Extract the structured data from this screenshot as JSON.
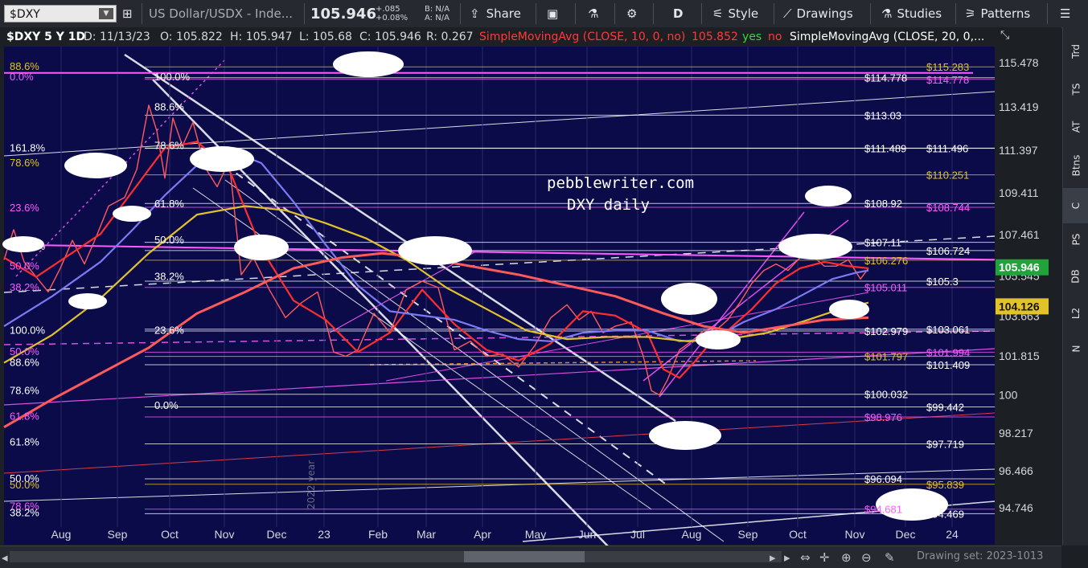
{
  "toolbar": {
    "symbol": "$DXY",
    "name": "US Dollar/USDX - Inde...",
    "last": "105.946",
    "change": "+.085",
    "change_pct": "+0.08%",
    "bid": "B: N/A",
    "ask": "A: N/A",
    "share": "Share",
    "period": "D",
    "style": "Style",
    "drawings": "Drawings",
    "studies": "Studies",
    "patterns": "Patterns"
  },
  "infobar": {
    "title": "$DXY 5 Y 1D",
    "date": "D: 11/13/23",
    "open": "O: 105.822",
    "high": "H: 105.947",
    "low": "L: 105.68",
    "close": "C: 105.946",
    "range": "R: 0.267",
    "sma10": "SimpleMovingAvg (CLOSE, 10, 0, no)",
    "sma10_val": "105.852",
    "yes": "yes",
    "no": "no",
    "sma20": "SimpleMovingAvg (CLOSE, 20, 0,..."
  },
  "sidebar": [
    "Trd",
    "TS",
    "AT",
    "Btns",
    "C",
    "PS",
    "DB",
    "L2",
    "N"
  ],
  "bottom": {
    "drawing_set": "Drawing set: 2023-1013"
  },
  "chart_data": {
    "type": "line",
    "title": "$DXY 5 Y 1D",
    "watermark": [
      "pebblewriter.com",
      "DXY daily"
    ],
    "year_label": "2022 year",
    "x_ticks": [
      "Aug",
      "Sep",
      "Oct",
      "Nov",
      "Dec",
      "23",
      "Feb",
      "Mar",
      "Apr",
      "May",
      "Jun",
      "Jul",
      "Aug",
      "Sep",
      "Oct",
      "Nov",
      "Dec",
      "24"
    ],
    "y_ticks": [
      115.478,
      113.419,
      111.397,
      109.411,
      107.461,
      105.545,
      103.663,
      101.815,
      100,
      98.217,
      96.466,
      94.746
    ],
    "ylim": [
      93.5,
      116.5
    ],
    "last_price": 105.946,
    "sma_badge": 104.126,
    "series": [
      {
        "name": "DXY",
        "color": "#ff5a5a",
        "x": [
          0,
          12,
          25,
          40,
          55,
          70,
          85,
          100,
          115,
          130,
          150,
          165,
          180,
          190,
          200,
          210,
          222,
          235,
          250,
          265,
          280,
          295,
          310,
          330,
          350,
          370,
          390,
          410,
          425,
          440,
          460,
          480,
          500,
          520,
          540,
          560,
          580,
          600,
          620,
          640,
          660,
          680,
          700,
          715,
          730,
          745,
          760,
          780,
          795,
          805,
          815,
          825,
          840,
          855,
          870,
          885,
          900,
          915,
          930,
          945,
          960,
          975,
          990,
          1005,
          1020,
          1035,
          1050,
          1065,
          1075
        ],
        "y": [
          106.3,
          107.7,
          106.2,
          105.5,
          104.8,
          105.9,
          107.2,
          106.1,
          107.4,
          108.8,
          109.2,
          110.5,
          113.5,
          112.3,
          110.1,
          112.9,
          111.6,
          112.7,
          110.6,
          109.7,
          110.9,
          105.6,
          106.4,
          104.9,
          103.6,
          104.3,
          104.8,
          102.0,
          101.8,
          102.1,
          103.8,
          102.9,
          104.9,
          105.3,
          105.0,
          102.1,
          102.5,
          101.8,
          101.9,
          101.3,
          102.3,
          103.6,
          104.2,
          103.5,
          103.9,
          102.9,
          103.2,
          103.4,
          101.8,
          100.2,
          100.0,
          100.7,
          102.1,
          102.5,
          103.0,
          103.0,
          103.5,
          104.3,
          105.2,
          105.8,
          106.1,
          105.8,
          106.4,
          106.5,
          106.0,
          106.0,
          106.3,
          105.4,
          105.9
        ]
      },
      {
        "name": "SMA 10",
        "color": "#ff2d2d",
        "x": [
          0,
          40,
          80,
          120,
          160,
          200,
          240,
          280,
          320,
          360,
          400,
          440,
          480,
          520,
          560,
          600,
          640,
          680,
          720,
          760,
          800,
          820,
          840,
          860,
          880,
          900,
          930,
          960,
          990,
          1020,
          1050,
          1075
        ],
        "y": [
          106.4,
          105.5,
          106.5,
          107.5,
          109.5,
          111.5,
          111.8,
          110.5,
          106.8,
          104.4,
          103.5,
          102.0,
          102.9,
          104.9,
          103.3,
          102.1,
          101.6,
          102.4,
          103.9,
          103.7,
          102.9,
          101.2,
          100.8,
          101.6,
          102.5,
          103.0,
          104.0,
          105.2,
          105.9,
          106.2,
          106.0,
          105.9
        ]
      },
      {
        "name": "SMA 50",
        "color": "#7a7af2",
        "x": [
          0,
          60,
          120,
          160,
          200,
          240,
          280,
          320,
          360,
          400,
          440,
          480,
          520,
          560,
          600,
          640,
          680,
          720,
          760,
          800,
          840,
          880,
          920,
          960,
          1000,
          1030,
          1060,
          1075
        ],
        "y": [
          103.2,
          104.6,
          106.2,
          107.7,
          109.3,
          110.7,
          111.4,
          110.8,
          109.0,
          107.0,
          105.1,
          103.9,
          103.7,
          103.5,
          103.0,
          102.6,
          102.5,
          102.9,
          103.0,
          103.0,
          102.5,
          102.6,
          103.4,
          104.0,
          104.8,
          105.4,
          105.7,
          105.8
        ]
      },
      {
        "name": "SMA 100",
        "color": "#e2c22a",
        "x": [
          0,
          60,
          120,
          180,
          240,
          300,
          350,
          400,
          450,
          500,
          550,
          600,
          650,
          700,
          750,
          800,
          850,
          900,
          950,
          1000,
          1040,
          1075
        ],
        "y": [
          101.5,
          102.8,
          104.5,
          106.6,
          108.4,
          108.8,
          108.6,
          108.0,
          107.3,
          106.3,
          105.0,
          104.0,
          103.0,
          102.6,
          102.7,
          102.7,
          102.5,
          102.6,
          102.9,
          103.5,
          104.0,
          104.3
        ]
      },
      {
        "name": "SMA 200",
        "color": "#ff5a5a",
        "x": [
          0,
          60,
          120,
          180,
          240,
          300,
          360,
          420,
          470,
          520,
          580,
          640,
          700,
          760,
          820,
          870,
          920,
          970,
          1020,
          1075
        ],
        "y": [
          98.5,
          99.8,
          101.0,
          102.2,
          103.8,
          104.8,
          105.9,
          106.4,
          106.6,
          106.4,
          106.0,
          105.6,
          105.1,
          104.6,
          103.8,
          103.2,
          102.9,
          103.2,
          103.5,
          103.6
        ]
      }
    ],
    "price_labels": [
      {
        "text": "$115.283",
        "color": "#e2c22a",
        "y": 115.283
      },
      {
        "text": "$114.778",
        "color": "#ffffff",
        "y": 114.778
      },
      {
        "text": "$114.778",
        "color": "#ff5aff",
        "y": 114.7
      },
      {
        "text": "$113.03",
        "color": "#ffffff",
        "y": 113.03
      },
      {
        "text": "$111.496",
        "color": "#ffffff",
        "y": 111.496
      },
      {
        "text": "$111.489",
        "color": "#ffffff",
        "y": 111.489
      },
      {
        "text": "$110.251",
        "color": "#e2c22a",
        "y": 110.251
      },
      {
        "text": "$108.92",
        "color": "#ffffff",
        "y": 108.92
      },
      {
        "text": "$108.744",
        "color": "#ff5aff",
        "y": 108.744
      },
      {
        "text": "$107.11",
        "color": "#ffffff",
        "y": 107.11
      },
      {
        "text": "$106.724",
        "color": "#ffffff",
        "y": 106.724
      },
      {
        "text": "$106.276",
        "color": "#e2c22a",
        "y": 106.276
      },
      {
        "text": "$105.3",
        "color": "#ffffff",
        "y": 105.3
      },
      {
        "text": "$105.011",
        "color": "#ff5aff",
        "y": 105.011
      },
      {
        "text": "$103.061",
        "color": "#ffffff",
        "y": 103.061
      },
      {
        "text": "$102.979",
        "color": "#ffffff",
        "y": 102.979
      },
      {
        "text": "$101.994",
        "color": "#ff5aff",
        "y": 101.994
      },
      {
        "text": "$101.797",
        "color": "#e2c22a",
        "y": 101.797
      },
      {
        "text": "$101.409",
        "color": "#ffffff",
        "y": 101.409
      },
      {
        "text": "$100.032",
        "color": "#ffffff",
        "y": 100.032
      },
      {
        "text": "$99.442",
        "color": "#ffffff",
        "y": 99.442
      },
      {
        "text": "$98.976",
        "color": "#ff5aff",
        "y": 98.976
      },
      {
        "text": "$97.719",
        "color": "#ffffff",
        "y": 97.719
      },
      {
        "text": "$96.094",
        "color": "#ffffff",
        "y": 96.094
      },
      {
        "text": "$95.839",
        "color": "#e2c22a",
        "y": 95.839
      },
      {
        "text": "$94.681",
        "color": "#ff5aff",
        "y": 94.681
      },
      {
        "text": "$94.469",
        "color": "#ffffff",
        "y": 94.469
      }
    ],
    "fib_labels": [
      {
        "text": "88.6%",
        "color": "#e2c22a",
        "y": 115.3,
        "x": 12
      },
      {
        "text": "0.0%",
        "color": "#ff5aff",
        "y": 114.8,
        "x": 12
      },
      {
        "text": "100.0%",
        "color": "#ffffff",
        "y": 114.8,
        "x": 192
      },
      {
        "text": "88.6%",
        "color": "#ffffff",
        "y": 113.4,
        "x": 192
      },
      {
        "text": "161.8%",
        "color": "#ffffff",
        "y": 111.5,
        "x": 12
      },
      {
        "text": "78.6%",
        "color": "#ffffff",
        "y": 111.6,
        "x": 192
      },
      {
        "text": "78.6%",
        "color": "#e2c22a",
        "y": 110.8,
        "x": 12
      },
      {
        "text": "61.8%",
        "color": "#ffffff",
        "y": 108.9,
        "x": 192
      },
      {
        "text": "23.6%",
        "color": "#ff5aff",
        "y": 108.7,
        "x": 12
      },
      {
        "text": "127.2%",
        "color": "#ffffff",
        "y": 106.9,
        "x": 12
      },
      {
        "text": "50.0%",
        "color": "#ffffff",
        "y": 107.2,
        "x": 192
      },
      {
        "text": "50.0%",
        "color": "#ff5aff",
        "y": 106.0,
        "x": 12
      },
      {
        "text": "38.2%",
        "color": "#ffffff",
        "y": 105.5,
        "x": 192
      },
      {
        "text": "38.2%",
        "color": "#ff5aff",
        "y": 105.0,
        "x": 12
      },
      {
        "text": "100.0%",
        "color": "#ffffff",
        "y": 103.0,
        "x": 12
      },
      {
        "text": "23.6%",
        "color": "#ffffff",
        "y": 103.0,
        "x": 192
      },
      {
        "text": "50.0%",
        "color": "#ff5aff",
        "y": 102.0,
        "x": 12
      },
      {
        "text": "88.6%",
        "color": "#ffffff",
        "y": 101.5,
        "x": 12
      },
      {
        "text": "78.6%",
        "color": "#ffffff",
        "y": 100.2,
        "x": 12
      },
      {
        "text": "0.0%",
        "color": "#ffffff",
        "y": 99.5,
        "x": 192
      },
      {
        "text": "61.8%",
        "color": "#ff5aff",
        "y": 99.0,
        "x": 12
      },
      {
        "text": "61.8%",
        "color": "#ffffff",
        "y": 97.8,
        "x": 12
      },
      {
        "text": "50.0%",
        "color": "#ffffff",
        "y": 96.1,
        "x": 12
      },
      {
        "text": "50.0%",
        "color": "#e2c22a",
        "y": 95.8,
        "x": 12
      },
      {
        "text": "78.6%",
        "color": "#ff5aff",
        "y": 94.8,
        "x": 12
      },
      {
        "text": "38.2%",
        "color": "#ffffff",
        "y": 94.5,
        "x": 12
      }
    ]
  }
}
